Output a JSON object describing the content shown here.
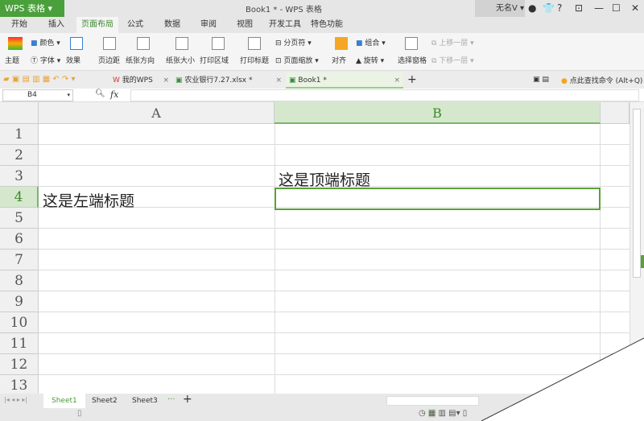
{
  "titlebar": {
    "app_button": "WPS 表格",
    "title": "Book1 * - WPS 表格",
    "user": "无名V",
    "help": "?"
  },
  "menu": [
    "开始",
    "插入",
    "页面布局",
    "公式",
    "数据",
    "审阅",
    "视图",
    "开发工具",
    "特色功能"
  ],
  "ribbon": {
    "theme": "主题",
    "color": "颜色",
    "font": "字体",
    "effect": "效果",
    "margins": "页边距",
    "orientation": "纸张方向",
    "size": "纸张大小",
    "print_area": "打印区域",
    "print_titles": "打印标题",
    "page_break": "分页符",
    "page_zoom": "页面缩放",
    "align": "对齐",
    "group": "组合",
    "rotate": "旋转",
    "selection_pane": "选择窗格",
    "bring_forward": "上移一层",
    "send_backward": "下移一层"
  },
  "doctabs": [
    {
      "label": "我的WPS"
    },
    {
      "label": "农业银行7.27.xlsx *"
    },
    {
      "label": "Book1 *"
    }
  ],
  "search_command": "点此查找命令 (Alt+Q)",
  "formula": {
    "namebox": "B4",
    "fx": "fx",
    "value": ""
  },
  "columns": [
    "A",
    "B"
  ],
  "rows": [
    "1",
    "2",
    "3",
    "4",
    "5",
    "6",
    "7",
    "8",
    "9",
    "10",
    "11",
    "12",
    "13"
  ],
  "cells": {
    "B3": "这是顶端标题",
    "A4": "这是左端标题"
  },
  "sheets": [
    "Sheet1",
    "Sheet2",
    "Sheet3"
  ],
  "colors": {
    "accent": "#4aa03a"
  }
}
